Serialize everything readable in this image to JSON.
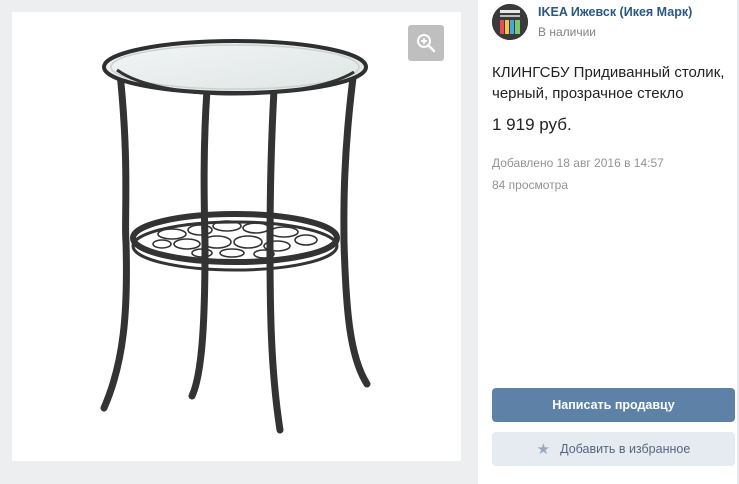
{
  "seller": {
    "name": "IKEA Ижевск (Икея Марк)",
    "status": "В наличии"
  },
  "product": {
    "title": "КЛИНГСБУ Придиванный столик, черный, прозрачное стекло",
    "price": "1 919 руб.",
    "added": "Добавлено 18 авг 2016 в 14:57",
    "views": "84 просмотра"
  },
  "actions": {
    "message_seller": "Написать продавцу",
    "add_favorite": "Добавить в избранное"
  },
  "icons": {
    "zoom": "zoom-in-icon",
    "favorite": "star-icon"
  },
  "colors": {
    "primary_button": "#5e81a8",
    "secondary_button": "#e5ebf1",
    "link": "#2a5885",
    "muted_text": "#939393",
    "gallery_background": "#edeef0"
  }
}
